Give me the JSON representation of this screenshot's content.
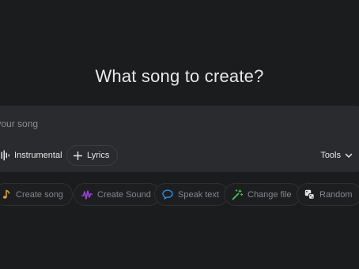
{
  "main": {
    "heading": "What song to create?"
  },
  "composer": {
    "placeholder": "ribe your song",
    "instrumental_label": "Instrumental",
    "lyrics_label": "Lyrics",
    "tools_label": "Tools"
  },
  "suggestions": [
    {
      "label": "Create song",
      "icon": "music-note-icon",
      "color": "#e0a22c"
    },
    {
      "label": "Create Sound",
      "icon": "soundwave-icon",
      "color": "#a23ee0"
    },
    {
      "label": "Speak text",
      "icon": "speech-bubble-icon",
      "color": "#2b8ee6"
    },
    {
      "label": "Change file",
      "icon": "magic-wand-icon",
      "color": "#3fcb5a"
    },
    {
      "label": "Random",
      "icon": "dice-icon",
      "color": "#e6e6e6"
    }
  ]
}
